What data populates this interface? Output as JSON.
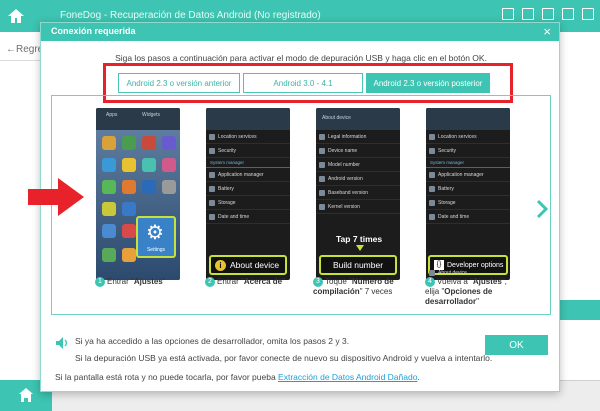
{
  "app": {
    "title": "FoneDog - Recuperación de Datos Android (No registrado)",
    "back_label": "←Regre"
  },
  "dialog": {
    "title": "Conexión requerida",
    "close": "×",
    "instruction": "Siga los pasos a continuación para activar el modo de depuración USB y haga clic en el botón OK.",
    "tabs": [
      {
        "label": "Android 2.3 o versión anterior",
        "active": false
      },
      {
        "label": "Android 3.0 - 4.1",
        "active": false
      },
      {
        "label": "Android 2.3 o versión posterior",
        "active": true
      }
    ],
    "phones": {
      "p1": {
        "tab_apps": "Apps",
        "tab_widgets": "Widgets",
        "settings_label": "Settings"
      },
      "p2": {
        "rows": [
          "Location services",
          "Security",
          "Application manager",
          "Battery",
          "Storage",
          "Date and time"
        ],
        "section": "System manager",
        "callout": "About device"
      },
      "p3": {
        "header": "About device",
        "rows": [
          "Legal information",
          "Device name",
          "Model number",
          "Android version",
          "Baseband version",
          "Kernel version"
        ],
        "tap_text": "Tap 7 times",
        "callout": "Build number"
      },
      "p4": {
        "rows": [
          "Location services",
          "Security",
          "Application manager",
          "Battery",
          "Storage",
          "Date and time"
        ],
        "section": "System manager",
        "bottom_row": "About device",
        "callout": "Developer options"
      }
    },
    "steps": [
      {
        "num": "1",
        "pre": "Entrar \"",
        "bold": "Ajustes",
        "post": "\""
      },
      {
        "num": "2",
        "pre": "Entrar \"",
        "bold": "Acerca de",
        "post": "\""
      },
      {
        "num": "3",
        "pre": "Toque \"",
        "bold": "Número de compilación",
        "post": "\" 7 veces"
      },
      {
        "num": "4",
        "pre": "Vuelva a \"",
        "bold": "Ajustes",
        "mid": "\", elija \"",
        "bold2": "Opciones de desarrollador",
        "post": "\""
      }
    ],
    "notes": [
      "Si ya ha accedido a las opciones de desarrollador, omita los pasos 2 y 3.",
      "Si la depuración USB ya está activada, por favor conecte de nuevo su dispositivo Android y vuelva a intentarlo."
    ],
    "ok_label": "OK",
    "footer_text": "Si la pantalla está rota y no puede tocarla, por favor pueba ",
    "footer_link": "Extracción de Datos Android Dañado",
    "footer_end": "."
  },
  "colors": {
    "accent": "#3ec4b2",
    "highlight": "#e8222b",
    "link": "#1a9fd8"
  }
}
